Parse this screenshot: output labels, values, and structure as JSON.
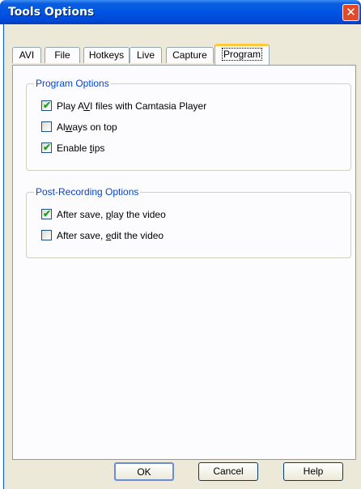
{
  "window": {
    "title": "Tools Options",
    "close_glyph": "✕"
  },
  "tabs": [
    {
      "label": "AVI"
    },
    {
      "label": "File"
    },
    {
      "label": "Hotkeys"
    },
    {
      "label": "Live"
    },
    {
      "label": "Capture"
    },
    {
      "label": "Program"
    }
  ],
  "active_tab": "Program",
  "program_options": {
    "title": "Program Options",
    "items": [
      {
        "pre": "Play A",
        "u": "V",
        "post": "I files with Camtasia Player",
        "checked": true
      },
      {
        "pre": "Al",
        "u": "w",
        "post": "ays on top",
        "checked": false
      },
      {
        "pre": "Enable ",
        "u": "t",
        "post": "ips",
        "checked": true
      }
    ]
  },
  "post_recording": {
    "title": "Post-Recording Options",
    "items": [
      {
        "pre": "After save, ",
        "u": "p",
        "post": "lay the video",
        "checked": true
      },
      {
        "pre": "After save, ",
        "u": "e",
        "post": "dit the video",
        "checked": false
      }
    ]
  },
  "buttons": {
    "ok": "OK",
    "cancel": "Cancel",
    "help": "Help"
  }
}
